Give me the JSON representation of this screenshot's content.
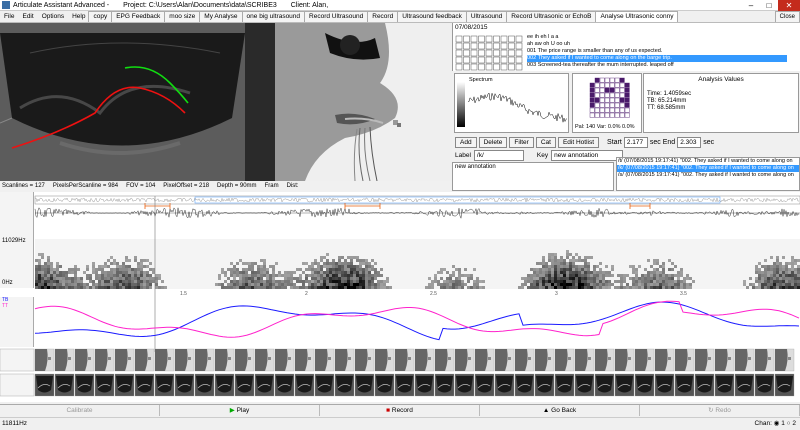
{
  "window": {
    "app": "Articulate Assistant Advanced -",
    "project": "Project: C:\\Users\\Alan\\Documents\\data\\SCRIBE3",
    "client": "Client: Alan,"
  },
  "menu": {
    "items": [
      "File",
      "Edit",
      "Options",
      "Help"
    ],
    "tabs": [
      "copy",
      "EPG Feedback",
      "moo size",
      "My Analyse",
      "one big ultrasound",
      "Record Ultrasound",
      "Record",
      "Ultrasound feedback",
      "Ultrasound",
      "Record Ultrasonic or EchoB",
      "Analyse Ultrasonic conny"
    ],
    "active_tab": "Analyse Ultrasonic conny",
    "close_tab": "Close"
  },
  "ultrasound_info": {
    "scanlines": "Scanlines = 127",
    "pixels": "PixelsPerScanline = 984",
    "fov": "FOV = 104",
    "pixel_offset": "PixelOffset = 218",
    "depth": "Depth = 90mm",
    "fram": "Fram",
    "dist": "Dist:"
  },
  "prompts": {
    "date": "07/08/2015",
    "sentences": [
      {
        "id": "",
        "text": "ee ih eh l a a",
        "selected": false
      },
      {
        "id": "",
        "text": "ah aw oh U oo uh",
        "selected": false
      },
      {
        "id": "001",
        "text": "The price range is smaller than any of us expected.",
        "selected": false
      },
      {
        "id": "002",
        "text": "They asked if I wanted to come along on the barge trip.",
        "selected": true
      },
      {
        "id": "003",
        "text": "Screened-tea thereafter the mum interrupted. leaped off",
        "selected": false
      }
    ]
  },
  "spectrum": {
    "title": "Spectrum"
  },
  "epg": {
    "pal": "Pal: 140 Var: 0.0%  0.0%"
  },
  "analysis": {
    "title": "Analysis Values",
    "time": "Time: 1.4059sec",
    "tb": "TB: 65.214mm",
    "tt": "TT: 68.585mm"
  },
  "controls": {
    "add": "Add",
    "delete": "Delete",
    "filter": "Filter",
    "cat": "Cat",
    "edit_hotlist": "Edit Hotlist",
    "start_label": "Start",
    "start_value": "2.177",
    "sec1": "sec",
    "end_label": "End",
    "end_value": "2.303",
    "sec2": "sec"
  },
  "label_row": {
    "label": "Label",
    "label_value": "/k/",
    "key": "Key",
    "key_value": "new annotation"
  },
  "annotation_text": "new annotation",
  "hotlist": [
    {
      "text": "/t/ (07/08/2015 19:17:41) \"002.  They asked if I wanted to come along on",
      "selected": false
    },
    {
      "text": "/k/ (07/08/2015 19:17:41) \"002.  They asked if I wanted to come along on",
      "selected": true
    },
    {
      "text": "/s/ (07/08/2015 19:17:41) \"002.  They asked if I wanted to come along on",
      "selected": false
    }
  ],
  "tracks": {
    "freq_top": "11029Hz",
    "freq_bottom": "0Hz",
    "tb": "TB",
    "tt": "TT",
    "tick_labels": [
      "1.5",
      "2",
      "2.5",
      "3",
      "3.5"
    ]
  },
  "bottom": {
    "calibrate": "Calibrate",
    "play": "Play",
    "record": "Record",
    "go_back": "Go Back",
    "redo": "Redo"
  },
  "status": {
    "left": "11811Hz",
    "chan": "Chan:",
    "chan1": "1",
    "chan2": "2"
  },
  "colors": {
    "tb": "#1a1aff",
    "tt": "#ff22cc",
    "selection": "#3399ff",
    "close": "#c42b1c"
  }
}
